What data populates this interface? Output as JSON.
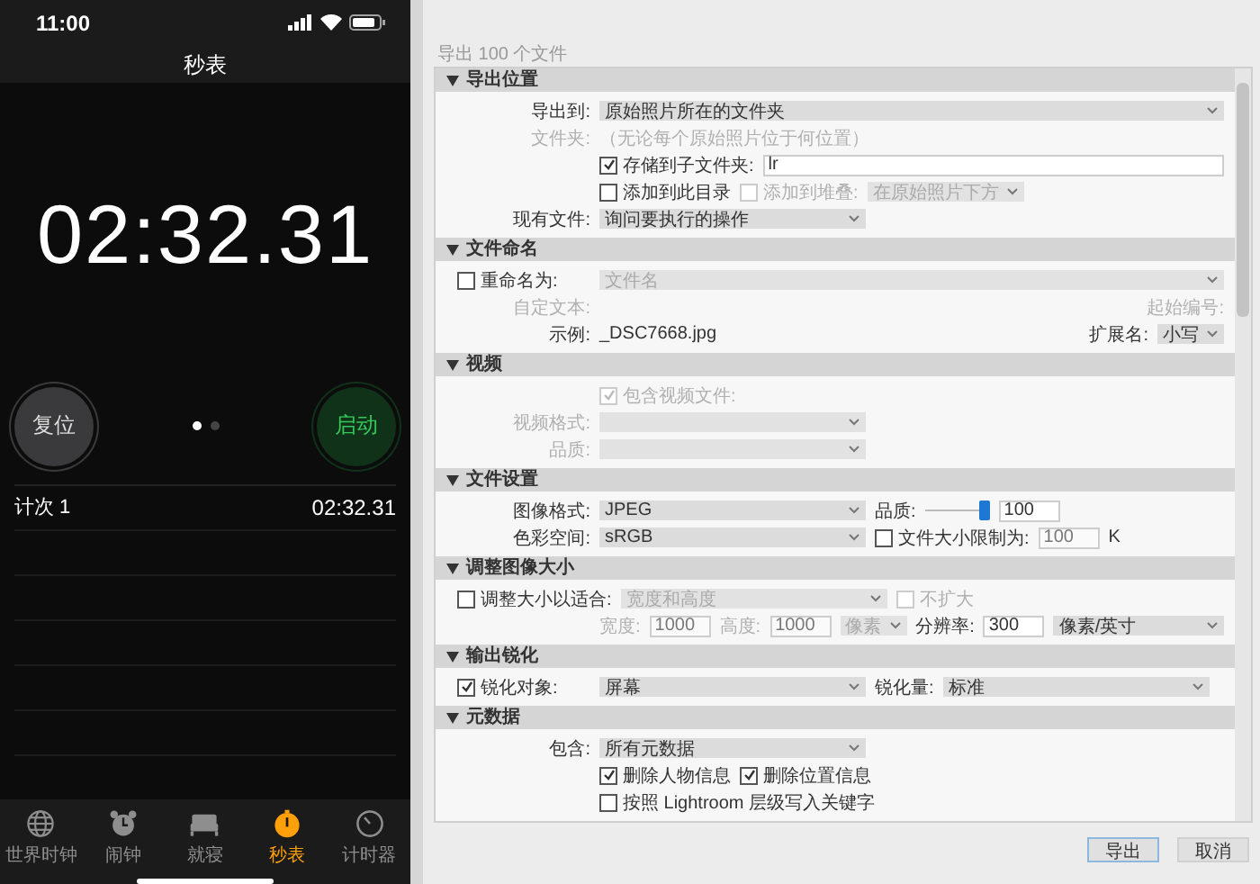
{
  "phone": {
    "status_time": "11:00",
    "title": "秒表",
    "elapsed": "02:32.31",
    "reset_button": "复位",
    "start_button": "启动",
    "pages": [
      {
        "selected": true
      },
      {
        "selected": false
      }
    ],
    "laps": [
      {
        "label": "计次 1",
        "time": "02:32.31"
      }
    ],
    "tabs": [
      {
        "label": "世界时钟",
        "selected": false
      },
      {
        "label": "闹钟",
        "selected": false
      },
      {
        "label": "就寝",
        "selected": false
      },
      {
        "label": "秒表",
        "selected": true
      },
      {
        "label": "计时器",
        "selected": false
      }
    ]
  },
  "export": {
    "count_text": "导出 100 个文件",
    "sections": [
      {
        "title": "导出位置",
        "expanded": true,
        "rows": [
          {
            "kind": "form",
            "items": [
              {
                "kind": "label",
                "text": "导出到:",
                "disabled": false
              },
              {
                "kind": "wide-dropdown",
                "value": "原始照片所在的文件夹",
                "disabled": false
              }
            ]
          },
          {
            "kind": "form",
            "items": [
              {
                "kind": "label",
                "text": "文件夹:",
                "disabled": true
              },
              {
                "kind": "text",
                "text": "（无论每个原始照片位于何位置）",
                "disabled": true
              }
            ]
          },
          {
            "kind": "indented",
            "items": [
              {
                "kind": "checkbox",
                "label": "存储到子文件夹:",
                "checked": true,
                "disabled": false
              },
              {
                "kind": "wide-field",
                "value": "lr",
                "disabled": false
              }
            ]
          },
          {
            "kind": "indented",
            "items": [
              {
                "kind": "checkbox",
                "label": "添加到此目录",
                "checked": false,
                "disabled": false
              },
              {
                "kind": "checkbox",
                "label": "添加到堆叠:",
                "checked": false,
                "disabled": true
              },
              {
                "kind": "small-dropdown",
                "value": "在原始照片下方",
                "disabled": true
              }
            ]
          },
          {
            "kind": "form",
            "items": [
              {
                "kind": "label",
                "text": "现有文件:",
                "disabled": false
              },
              {
                "kind": "dropdown",
                "value": "询问要执行的操作",
                "disabled": false
              }
            ]
          }
        ]
      },
      {
        "title": "文件命名",
        "expanded": true,
        "rows": [
          {
            "kind": "form",
            "items": [
              {
                "kind": "checkbox",
                "label": "重命名为:",
                "checked": false,
                "disabled": false
              },
              {
                "kind": "wide-dropdown",
                "value": "文件名",
                "disabled": true
              }
            ]
          },
          {
            "kind": "form",
            "items": [
              {
                "kind": "label",
                "text": "自定文本:",
                "disabled": true
              }
            ],
            "right": [
              {
                "kind": "label",
                "text": "起始编号:",
                "disabled": true
              }
            ]
          },
          {
            "kind": "form",
            "items": [
              {
                "kind": "label",
                "text": "示例:",
                "disabled": false
              },
              {
                "kind": "text",
                "text": "_DSC7668.jpg",
                "disabled": false
              }
            ],
            "right": [
              {
                "kind": "label",
                "text": "扩展名:",
                "disabled": false
              },
              {
                "kind": "small-dropdown",
                "value": "小写",
                "disabled": false
              }
            ]
          }
        ]
      },
      {
        "title": "视频",
        "expanded": true,
        "rows": [
          {
            "kind": "indented",
            "items": [
              {
                "kind": "checkbox",
                "label": "包含视频文件:",
                "checked": true,
                "disabled": true
              }
            ]
          },
          {
            "kind": "form",
            "items": [
              {
                "kind": "label",
                "text": "视频格式:",
                "disabled": true
              },
              {
                "kind": "dropdown",
                "disabled": true
              }
            ]
          },
          {
            "kind": "form",
            "items": [
              {
                "kind": "label",
                "text": "品质:",
                "disabled": true
              },
              {
                "kind": "dropdown",
                "disabled": true
              }
            ]
          }
        ]
      },
      {
        "title": "文件设置",
        "expanded": true,
        "rows": [
          {
            "kind": "form",
            "items": [
              {
                "kind": "label",
                "text": "图像格式:",
                "disabled": false
              },
              {
                "kind": "dropdown",
                "value": "JPEG",
                "disabled": false
              },
              {
                "kind": "label",
                "text": "品质:",
                "disabled": false
              },
              {
                "kind": "slider",
                "level": 1
              },
              {
                "kind": "field",
                "value": "100",
                "disabled": false
              }
            ]
          },
          {
            "kind": "form",
            "items": [
              {
                "kind": "label",
                "text": "色彩空间:",
                "disabled": false
              },
              {
                "kind": "dropdown",
                "value": "sRGB",
                "disabled": false
              },
              {
                "kind": "checkbox",
                "label": "文件大小限制为:",
                "checked": false,
                "disabled": false
              },
              {
                "kind": "field",
                "value": "100",
                "disabled": true
              },
              {
                "kind": "text",
                "text": "K",
                "disabled": false
              }
            ]
          }
        ]
      },
      {
        "title": "调整图像大小",
        "expanded": true,
        "rows": [
          {
            "kind": "form",
            "items": [
              {
                "kind": "checkbox",
                "label": "调整大小以适合:",
                "checked": false,
                "disabled": false
              },
              {
                "kind": "dropdown",
                "value": "宽度和高度",
                "disabled": true
              },
              {
                "kind": "checkbox",
                "label": "不扩大",
                "checked": false,
                "disabled": true
              }
            ]
          },
          {
            "kind": "indented",
            "items": [
              {
                "kind": "label",
                "text": "宽度:",
                "disabled": true
              },
              {
                "kind": "field",
                "value": "1000",
                "disabled": true
              },
              {
                "kind": "label",
                "text": "高度:",
                "disabled": true
              },
              {
                "kind": "field",
                "value": "1000",
                "disabled": true
              },
              {
                "kind": "small-dropdown",
                "value": "像素",
                "disabled": true
              },
              {
                "kind": "label",
                "text": "分辨率:",
                "disabled": false
              },
              {
                "kind": "field",
                "value": "300",
                "disabled": false
              },
              {
                "kind": "wide-dropdown",
                "value": "像素/英寸",
                "disabled": false
              }
            ]
          }
        ]
      },
      {
        "title": "输出锐化",
        "expanded": true,
        "rows": [
          {
            "kind": "form",
            "items": [
              {
                "kind": "checkbox",
                "label": "锐化对象:",
                "checked": true,
                "disabled": false
              },
              {
                "kind": "dropdown",
                "value": "屏幕",
                "disabled": false
              },
              {
                "kind": "label",
                "text": "锐化量:",
                "disabled": false
              },
              {
                "kind": "dropdown",
                "value": "标准",
                "disabled": false
              }
            ]
          }
        ]
      },
      {
        "title": "元数据",
        "expanded": true,
        "rows": [
          {
            "kind": "form",
            "items": [
              {
                "kind": "label",
                "text": "包含:",
                "disabled": false
              },
              {
                "kind": "dropdown",
                "value": "所有元数据",
                "disabled": false
              }
            ]
          },
          {
            "kind": "indented",
            "items": [
              {
                "kind": "checkbox",
                "label": "删除人物信息",
                "checked": true,
                "disabled": false
              },
              {
                "kind": "checkbox",
                "label": "删除位置信息",
                "checked": true,
                "disabled": false
              }
            ]
          },
          {
            "kind": "indented",
            "items": [
              {
                "kind": "checkbox",
                "label": "按照 Lightroom 层级写入关键字",
                "checked": false,
                "disabled": false
              }
            ]
          }
        ]
      }
    ],
    "buttons": [
      {
        "label": "导出",
        "default": true
      },
      {
        "label": "取消",
        "default": false
      }
    ]
  }
}
